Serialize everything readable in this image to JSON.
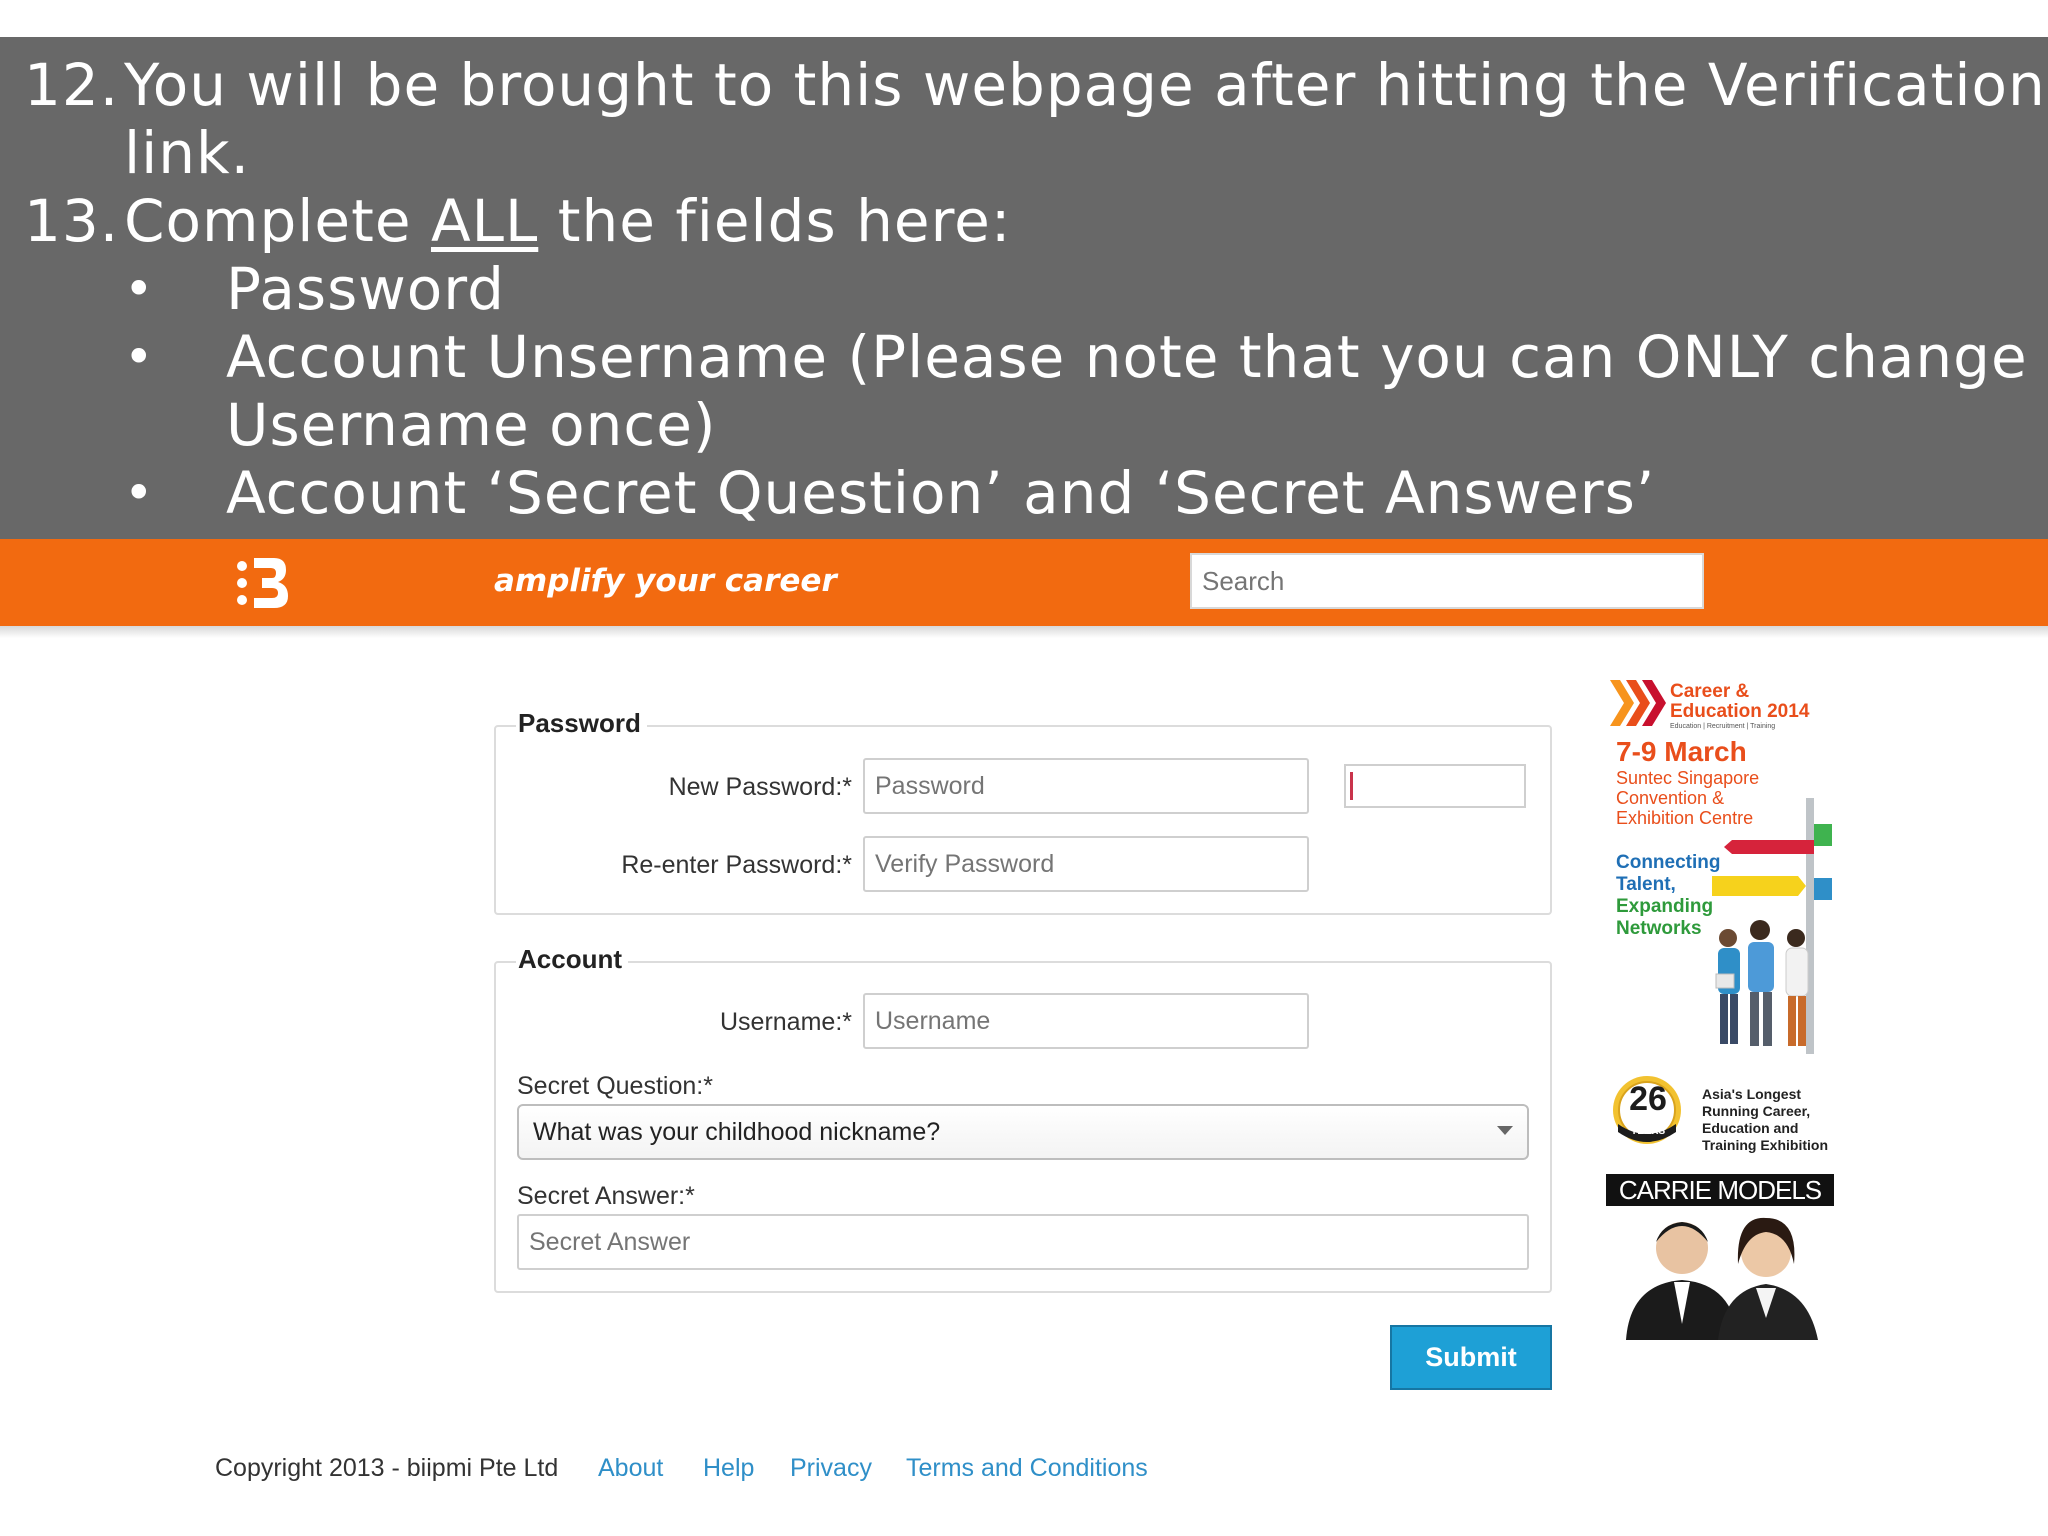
{
  "instructions": {
    "step12_num": "12.",
    "step12_line1": "You will be brought to this webpage after hitting the Verification",
    "step12_line2": "link.",
    "step13_num": "13.",
    "step13_pre": "Complete ",
    "step13_emph": "ALL",
    "step13_post": " the fields here:",
    "bullet_char": "•",
    "bullet1": "Password",
    "bullet2_line1": "Account Unsername (Please note that you can ONLY change the",
    "bullet2_line2": "Username once)",
    "bullet3": "Account ‘Secret Question’ and ‘Secret Answers’"
  },
  "header": {
    "logo_icon": "biipmi-logo-icon",
    "tagline": "amplify your career",
    "search_placeholder": "Search",
    "brand_color": "#f26a10"
  },
  "form": {
    "password_legend": "Password",
    "new_password_label": "New Password:*",
    "new_password_placeholder": "Password",
    "reenter_password_label": "Re-enter Password:*",
    "reenter_password_placeholder": "Verify Password",
    "account_legend": "Account",
    "username_label": "Username:*",
    "username_placeholder": "Username",
    "secret_question_label": "Secret Question:*",
    "secret_question_value": "What was your childhood nickname?",
    "secret_answer_label": "Secret Answer:*",
    "secret_answer_placeholder": "Secret Answer",
    "submit_label": "Submit",
    "submit_color": "#1ea0d6"
  },
  "ad": {
    "title_line1": "Career &",
    "title_line2": "Education 2014",
    "subtitle": "Education | Recruitment | Training",
    "dates": "7-9 March",
    "venue_line1": "Suntec Singapore",
    "venue_line2": "Convention &",
    "venue_line3": "Exhibition Centre",
    "tag_line1": "Connecting",
    "tag_line2": "Talent,",
    "tag_line3": "Expanding",
    "tag_line4": "Networks",
    "badge_number": "26",
    "badge_label": "YEARS",
    "badge_text_line1": "Asia's Longest",
    "badge_text_line2": "Running Career,",
    "badge_text_line3": "Education and",
    "badge_text_line4": "Training Exhibition",
    "sponsor": "CARRIE MODELS"
  },
  "footer": {
    "copyright": "Copyright 2013 - biipmi Pte Ltd",
    "links": [
      "About",
      "Help",
      "Privacy",
      "Terms and Conditions"
    ]
  }
}
